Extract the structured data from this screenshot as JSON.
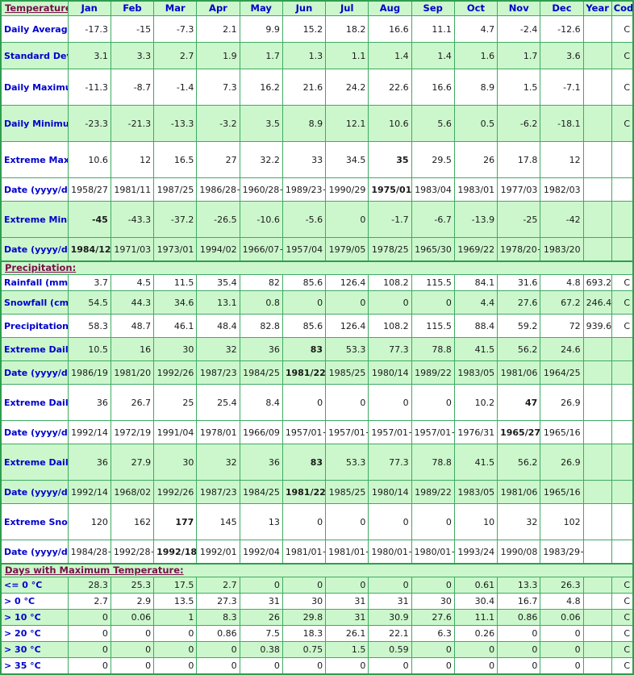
{
  "header": {
    "title_label": "Temperature:",
    "months": [
      "Jan",
      "Feb",
      "Mar",
      "Apr",
      "May",
      "Jun",
      "Jul",
      "Aug",
      "Sep",
      "Oct",
      "Nov",
      "Dec"
    ],
    "year_label": "Year",
    "code_label": "Code"
  },
  "sections": {
    "precipitation_label": "Precipitation:",
    "days_max_temp_label": "Days with Maximum Temperature:"
  },
  "colors": {
    "band_green": "#CCF7CC",
    "border_green": "#3FAA63",
    "outer_border": "#2E9E4F",
    "label_blue": "#0000CC",
    "section_maroon": "#7A0F4A",
    "value_black": "#1A1A1A"
  },
  "rows": [
    {
      "id": "daily-average",
      "label": "Daily Average (°C)",
      "band": "white",
      "height": "tall",
      "values": [
        "-17.3",
        "-15",
        "-7.3",
        "2.1",
        "9.9",
        "15.2",
        "18.2",
        "16.6",
        "11.1",
        "4.7",
        "-2.4",
        "-12.6"
      ],
      "bold": [
        false,
        false,
        false,
        false,
        false,
        false,
        false,
        false,
        false,
        false,
        false,
        false
      ],
      "year": "",
      "code": "C"
    },
    {
      "id": "standard-deviation",
      "label": "Standard Deviation",
      "band": "green",
      "height": "tall",
      "values": [
        "3.1",
        "3.3",
        "2.7",
        "1.9",
        "1.7",
        "1.3",
        "1.1",
        "1.4",
        "1.4",
        "1.6",
        "1.7",
        "3.6"
      ],
      "bold": [
        false,
        false,
        false,
        false,
        false,
        false,
        false,
        false,
        false,
        false,
        false,
        false
      ],
      "year": "",
      "code": "C"
    },
    {
      "id": "daily-maximum",
      "label": "Daily Maximum (°C)",
      "band": "white",
      "height": "xtall",
      "values": [
        "-11.3",
        "-8.7",
        "-1.4",
        "7.3",
        "16.2",
        "21.6",
        "24.2",
        "22.6",
        "16.6",
        "8.9",
        "1.5",
        "-7.1"
      ],
      "bold": [
        false,
        false,
        false,
        false,
        false,
        false,
        false,
        false,
        false,
        false,
        false,
        false
      ],
      "year": "",
      "code": "C"
    },
    {
      "id": "daily-minimum",
      "label": "Daily Minimum (°C)",
      "band": "green",
      "height": "xtall",
      "values": [
        "-23.3",
        "-21.3",
        "-13.3",
        "-3.2",
        "3.5",
        "8.9",
        "12.1",
        "10.6",
        "5.6",
        "0.5",
        "-6.2",
        "-18.1"
      ],
      "bold": [
        false,
        false,
        false,
        false,
        false,
        false,
        false,
        false,
        false,
        false,
        false,
        false
      ],
      "year": "",
      "code": "C"
    },
    {
      "id": "extreme-maximum",
      "label": "Extreme Maximum (°C)",
      "band": "white",
      "height": "xtall",
      "values": [
        "10.6",
        "12",
        "16.5",
        "27",
        "32.2",
        "33",
        "34.5",
        "35",
        "29.5",
        "26",
        "17.8",
        "12"
      ],
      "bold": [
        false,
        false,
        false,
        false,
        false,
        false,
        false,
        true,
        false,
        false,
        false,
        false
      ],
      "year": "",
      "code": ""
    },
    {
      "id": "extreme-maximum-date",
      "label": "Date (yyyy/dd)",
      "band": "white",
      "height": "mid",
      "values": [
        "1958/27",
        "1981/11",
        "1987/25",
        "1986/28+",
        "1960/28+",
        "1989/23+",
        "1990/29",
        "1975/01",
        "1983/04",
        "1983/01",
        "1977/03",
        "1982/03"
      ],
      "bold": [
        false,
        false,
        false,
        false,
        false,
        false,
        false,
        true,
        false,
        false,
        false,
        false
      ],
      "year": "",
      "code": ""
    },
    {
      "id": "extreme-minimum",
      "label": "Extreme Minimum (°C)",
      "band": "green",
      "height": "xtall",
      "values": [
        "-45",
        "-43.3",
        "-37.2",
        "-26.5",
        "-10.6",
        "-5.6",
        "0",
        "-1.7",
        "-6.7",
        "-13.9",
        "-25",
        "-42"
      ],
      "bold": [
        true,
        false,
        false,
        false,
        false,
        false,
        false,
        false,
        false,
        false,
        false,
        false
      ],
      "year": "",
      "code": ""
    },
    {
      "id": "extreme-minimum-date",
      "label": "Date (yyyy/dd)",
      "band": "green",
      "height": "mid",
      "values": [
        "1984/12",
        "1971/03",
        "1973/01",
        "1994/02",
        "1966/07+",
        "1957/04",
        "1979/05",
        "1978/25",
        "1965/30",
        "1969/22",
        "1978/20+",
        "1983/20"
      ],
      "bold": [
        true,
        false,
        false,
        false,
        false,
        false,
        false,
        false,
        false,
        false,
        false,
        false
      ],
      "year": "",
      "code": ""
    },
    {
      "id": "rainfall",
      "label": "Rainfall (mm)",
      "band": "white",
      "height": "short",
      "values": [
        "3.7",
        "4.5",
        "11.5",
        "35.4",
        "82",
        "85.6",
        "126.4",
        "108.2",
        "115.5",
        "84.1",
        "31.6",
        "4.8"
      ],
      "bold": [
        false,
        false,
        false,
        false,
        false,
        false,
        false,
        false,
        false,
        false,
        false,
        false
      ],
      "year": "693.2",
      "code": "C"
    },
    {
      "id": "snowfall",
      "label": "Snowfall (cm)",
      "band": "green",
      "height": "mid",
      "values": [
        "54.5",
        "44.3",
        "34.6",
        "13.1",
        "0.8",
        "0",
        "0",
        "0",
        "0",
        "4.4",
        "27.6",
        "67.2"
      ],
      "bold": [
        false,
        false,
        false,
        false,
        false,
        false,
        false,
        false,
        false,
        false,
        false,
        false
      ],
      "year": "246.4",
      "code": "C"
    },
    {
      "id": "precipitation-total",
      "label": "Precipitation (mm)",
      "band": "white",
      "height": "mid",
      "values": [
        "58.3",
        "48.7",
        "46.1",
        "48.4",
        "82.8",
        "85.6",
        "126.4",
        "108.2",
        "115.5",
        "88.4",
        "59.2",
        "72"
      ],
      "bold": [
        false,
        false,
        false,
        false,
        false,
        false,
        false,
        false,
        false,
        false,
        false,
        false
      ],
      "year": "939.6",
      "code": "C"
    },
    {
      "id": "extreme-daily-rainfall",
      "label": "Extreme Daily Rainfall (mm)",
      "band": "green",
      "height": "mid",
      "values": [
        "10.5",
        "16",
        "30",
        "32",
        "36",
        "83",
        "53.3",
        "77.3",
        "78.8",
        "41.5",
        "56.2",
        "24.6"
      ],
      "bold": [
        false,
        false,
        false,
        false,
        false,
        true,
        false,
        false,
        false,
        false,
        false,
        false
      ],
      "year": "",
      "code": ""
    },
    {
      "id": "extreme-daily-rainfall-date",
      "label": "Date (yyyy/dd)",
      "band": "green",
      "height": "mid",
      "values": [
        "1986/19",
        "1981/20",
        "1992/26",
        "1987/23",
        "1984/25",
        "1981/22",
        "1985/25",
        "1980/14",
        "1989/22",
        "1983/05",
        "1981/06",
        "1964/25"
      ],
      "bold": [
        false,
        false,
        false,
        false,
        false,
        true,
        false,
        false,
        false,
        false,
        false,
        false
      ],
      "year": "",
      "code": ""
    },
    {
      "id": "extreme-daily-snowfall",
      "label": "Extreme Daily Snowfall (cm)",
      "band": "white",
      "height": "xtall",
      "values": [
        "36",
        "26.7",
        "25",
        "25.4",
        "8.4",
        "0",
        "0",
        "0",
        "0",
        "10.2",
        "47",
        "26.9"
      ],
      "bold": [
        false,
        false,
        false,
        false,
        false,
        false,
        false,
        false,
        false,
        false,
        true,
        false
      ],
      "year": "",
      "code": ""
    },
    {
      "id": "extreme-daily-snowfall-date",
      "label": "Date (yyyy/dd)",
      "band": "white",
      "height": "mid",
      "values": [
        "1992/14",
        "1972/19",
        "1991/04",
        "1978/01",
        "1966/09",
        "1957/01+",
        "1957/01+",
        "1957/01+",
        "1957/01+",
        "1976/31",
        "1965/27",
        "1965/16"
      ],
      "bold": [
        false,
        false,
        false,
        false,
        false,
        false,
        false,
        false,
        false,
        false,
        true,
        false
      ],
      "year": "",
      "code": ""
    },
    {
      "id": "extreme-daily-precipitation",
      "label": "Extreme Daily Precipitation (mm)",
      "band": "green",
      "height": "xtall",
      "values": [
        "36",
        "27.9",
        "30",
        "32",
        "36",
        "83",
        "53.3",
        "77.3",
        "78.8",
        "41.5",
        "56.2",
        "26.9"
      ],
      "bold": [
        false,
        false,
        false,
        false,
        false,
        true,
        false,
        false,
        false,
        false,
        false,
        false
      ],
      "year": "",
      "code": ""
    },
    {
      "id": "extreme-daily-precipitation-date",
      "label": "Date (yyyy/dd)",
      "band": "green",
      "height": "mid",
      "values": [
        "1992/14",
        "1968/02",
        "1992/26",
        "1987/23",
        "1984/25",
        "1981/22",
        "1985/25",
        "1980/14",
        "1989/22",
        "1983/05",
        "1981/06",
        "1965/16"
      ],
      "bold": [
        false,
        false,
        false,
        false,
        false,
        true,
        false,
        false,
        false,
        false,
        false,
        false
      ],
      "year": "",
      "code": ""
    },
    {
      "id": "extreme-snow-depth",
      "label": "Extreme Snow Depth (cm)",
      "band": "white",
      "height": "xtall",
      "values": [
        "120",
        "162",
        "177",
        "145",
        "13",
        "0",
        "0",
        "0",
        "0",
        "10",
        "32",
        "102"
      ],
      "bold": [
        false,
        false,
        true,
        false,
        false,
        false,
        false,
        false,
        false,
        false,
        false,
        false
      ],
      "year": "",
      "code": ""
    },
    {
      "id": "extreme-snow-depth-date",
      "label": "Date (yyyy/dd)",
      "band": "white",
      "height": "mid",
      "values": [
        "1984/28+",
        "1992/28+",
        "1992/18+",
        "1992/01",
        "1992/04",
        "1981/01+",
        "1981/01+",
        "1980/01+",
        "1980/01+",
        "1993/24",
        "1990/08",
        "1983/29+"
      ],
      "bold": [
        false,
        false,
        true,
        false,
        false,
        false,
        false,
        false,
        false,
        false,
        false,
        false
      ],
      "year": "",
      "code": ""
    },
    {
      "id": "days-le-0",
      "label": "<= 0 °C",
      "band": "green",
      "height": "short",
      "values": [
        "28.3",
        "25.3",
        "17.5",
        "2.7",
        "0",
        "0",
        "0",
        "0",
        "0",
        "0.61",
        "13.3",
        "26.3"
      ],
      "bold": [
        false,
        false,
        false,
        false,
        false,
        false,
        false,
        false,
        false,
        false,
        false,
        false
      ],
      "year": "",
      "code": "C"
    },
    {
      "id": "days-gt-0",
      "label": "> 0 °C",
      "band": "white",
      "height": "short",
      "values": [
        "2.7",
        "2.9",
        "13.5",
        "27.3",
        "31",
        "30",
        "31",
        "31",
        "30",
        "30.4",
        "16.7",
        "4.8"
      ],
      "bold": [
        false,
        false,
        false,
        false,
        false,
        false,
        false,
        false,
        false,
        false,
        false,
        false
      ],
      "year": "",
      "code": "C"
    },
    {
      "id": "days-gt-10",
      "label": "> 10 °C",
      "band": "green",
      "height": "short",
      "values": [
        "0",
        "0.06",
        "1",
        "8.3",
        "26",
        "29.8",
        "31",
        "30.9",
        "27.6",
        "11.1",
        "0.86",
        "0.06"
      ],
      "bold": [
        false,
        false,
        false,
        false,
        false,
        false,
        false,
        false,
        false,
        false,
        false,
        false
      ],
      "year": "",
      "code": "C"
    },
    {
      "id": "days-gt-20",
      "label": "> 20 °C",
      "band": "white",
      "height": "short",
      "values": [
        "0",
        "0",
        "0",
        "0.86",
        "7.5",
        "18.3",
        "26.1",
        "22.1",
        "6.3",
        "0.26",
        "0",
        "0"
      ],
      "bold": [
        false,
        false,
        false,
        false,
        false,
        false,
        false,
        false,
        false,
        false,
        false,
        false
      ],
      "year": "",
      "code": "C"
    },
    {
      "id": "days-gt-30",
      "label": "> 30 °C",
      "band": "green",
      "height": "short",
      "values": [
        "0",
        "0",
        "0",
        "0",
        "0.38",
        "0.75",
        "1.5",
        "0.59",
        "0",
        "0",
        "0",
        "0"
      ],
      "bold": [
        false,
        false,
        false,
        false,
        false,
        false,
        false,
        false,
        false,
        false,
        false,
        false
      ],
      "year": "",
      "code": "C"
    },
    {
      "id": "days-gt-35",
      "label": "> 35 °C",
      "band": "white",
      "height": "short",
      "values": [
        "0",
        "0",
        "0",
        "0",
        "0",
        "0",
        "0",
        "0",
        "0",
        "0",
        "0",
        "0"
      ],
      "bold": [
        false,
        false,
        false,
        false,
        false,
        false,
        false,
        false,
        false,
        false,
        false,
        false
      ],
      "year": "",
      "code": "C"
    }
  ]
}
